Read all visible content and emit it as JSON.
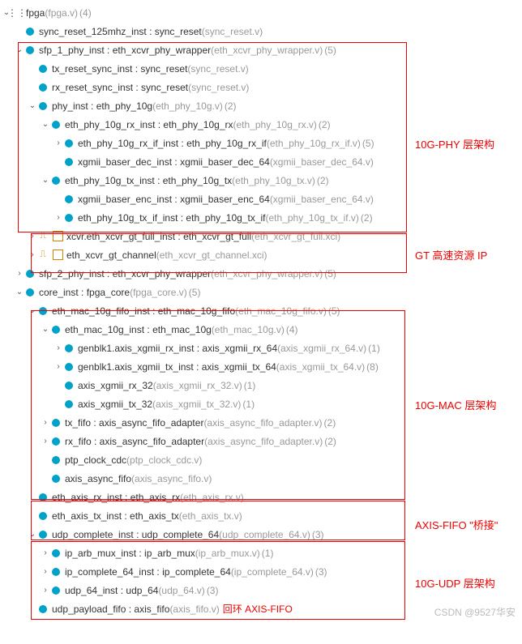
{
  "items": [
    {
      "d": 0,
      "a": "v",
      "i": "hier",
      "inst": "fpga",
      "file": "(fpga.v)",
      "cnt": "(4)"
    },
    {
      "d": 1,
      "a": "",
      "i": "dot",
      "inst": "sync_reset_125mhz_inst : sync_reset",
      "file": "(sync_reset.v)",
      "cnt": ""
    },
    {
      "d": 1,
      "a": "v",
      "i": "dot",
      "inst": "sfp_1_phy_inst : eth_xcvr_phy_wrapper",
      "file": "(eth_xcvr_phy_wrapper.v)",
      "cnt": "(5)"
    },
    {
      "d": 2,
      "a": "",
      "i": "dot",
      "inst": "tx_reset_sync_inst : sync_reset",
      "file": "(sync_reset.v)",
      "cnt": ""
    },
    {
      "d": 2,
      "a": "",
      "i": "dot",
      "inst": "rx_reset_sync_inst : sync_reset",
      "file": "(sync_reset.v)",
      "cnt": ""
    },
    {
      "d": 2,
      "a": "v",
      "i": "dot",
      "inst": "phy_inst : eth_phy_10g",
      "file": "(eth_phy_10g.v)",
      "cnt": "(2)"
    },
    {
      "d": 3,
      "a": "v",
      "i": "dot",
      "inst": "eth_phy_10g_rx_inst : eth_phy_10g_rx",
      "file": "(eth_phy_10g_rx.v)",
      "cnt": "(2)"
    },
    {
      "d": 4,
      "a": ">",
      "i": "dot",
      "inst": "eth_phy_10g_rx_if_inst : eth_phy_10g_rx_if",
      "file": "(eth_phy_10g_rx_if.v)",
      "cnt": "(5)"
    },
    {
      "d": 4,
      "a": "",
      "i": "dot",
      "inst": "xgmii_baser_dec_inst : xgmii_baser_dec_64",
      "file": "(xgmii_baser_dec_64.v)",
      "cnt": ""
    },
    {
      "d": 3,
      "a": "v",
      "i": "dot",
      "inst": "eth_phy_10g_tx_inst : eth_phy_10g_tx",
      "file": "(eth_phy_10g_tx.v)",
      "cnt": "(2)"
    },
    {
      "d": 4,
      "a": "",
      "i": "dot",
      "inst": "xgmii_baser_enc_inst : xgmii_baser_enc_64",
      "file": "(xgmii_baser_enc_64.v)",
      "cnt": ""
    },
    {
      "d": 4,
      "a": ">",
      "i": "dot",
      "inst": "eth_phy_10g_tx_if_inst : eth_phy_10g_tx_if",
      "file": "(eth_phy_10g_tx_if.v)",
      "cnt": "(2)"
    },
    {
      "d": 2,
      "a": ">",
      "i": "ip",
      "inst": "xcvr.eth_xcvr_gt_full_inst : eth_xcvr_gt_full",
      "file": "(eth_xcvr_gt_full.xci)",
      "cnt": ""
    },
    {
      "d": 2,
      "a": ">",
      "i": "ip",
      "inst": "eth_xcvr_gt_channel",
      "file": "(eth_xcvr_gt_channel.xci)",
      "cnt": ""
    },
    {
      "d": 1,
      "a": ">",
      "i": "dot",
      "inst": "sfp_2_phy_inst : eth_xcvr_phy_wrapper",
      "file": "(eth_xcvr_phy_wrapper.v)",
      "cnt": "(5)"
    },
    {
      "d": 1,
      "a": "v",
      "i": "dot",
      "inst": "core_inst : fpga_core",
      "file": "(fpga_core.v)",
      "cnt": "(5)"
    },
    {
      "d": 2,
      "a": "v",
      "i": "dot",
      "inst": "eth_mac_10g_fifo_inst : eth_mac_10g_fifo",
      "file": "(eth_mac_10g_fifo.v)",
      "cnt": "(5)"
    },
    {
      "d": 3,
      "a": "v",
      "i": "dot",
      "inst": "eth_mac_10g_inst : eth_mac_10g",
      "file": "(eth_mac_10g.v)",
      "cnt": "(4)"
    },
    {
      "d": 4,
      "a": ">",
      "i": "dot",
      "inst": "genblk1.axis_xgmii_rx_inst : axis_xgmii_rx_64",
      "file": "(axis_xgmii_rx_64.v)",
      "cnt": "(1)"
    },
    {
      "d": 4,
      "a": ">",
      "i": "dot",
      "inst": "genblk1.axis_xgmii_tx_inst : axis_xgmii_tx_64",
      "file": "(axis_xgmii_tx_64.v)",
      "cnt": "(8)"
    },
    {
      "d": 4,
      "a": "",
      "i": "dot",
      "inst": "axis_xgmii_rx_32",
      "file": "(axis_xgmii_rx_32.v)",
      "cnt": "(1)"
    },
    {
      "d": 4,
      "a": "",
      "i": "dot",
      "inst": "axis_xgmii_tx_32",
      "file": "(axis_xgmii_tx_32.v)",
      "cnt": "(1)"
    },
    {
      "d": 3,
      "a": ">",
      "i": "dot",
      "inst": "tx_fifo : axis_async_fifo_adapter",
      "file": "(axis_async_fifo_adapter.v)",
      "cnt": "(2)"
    },
    {
      "d": 3,
      "a": ">",
      "i": "dot",
      "inst": "rx_fifo : axis_async_fifo_adapter",
      "file": "(axis_async_fifo_adapter.v)",
      "cnt": "(2)"
    },
    {
      "d": 3,
      "a": "",
      "i": "dot",
      "inst": "ptp_clock_cdc",
      "file": "(ptp_clock_cdc.v)",
      "cnt": ""
    },
    {
      "d": 3,
      "a": "",
      "i": "dot",
      "inst": "axis_async_fifo",
      "file": "(axis_async_fifo.v)",
      "cnt": ""
    },
    {
      "d": 2,
      "a": "",
      "i": "dot",
      "inst": "eth_axis_rx_inst : eth_axis_rx",
      "file": "(eth_axis_rx.v)",
      "cnt": ""
    },
    {
      "d": 2,
      "a": "",
      "i": "dot",
      "inst": "eth_axis_tx_inst : eth_axis_tx",
      "file": "(eth_axis_tx.v)",
      "cnt": ""
    },
    {
      "d": 2,
      "a": "v",
      "i": "dot",
      "inst": "udp_complete_inst : udp_complete_64",
      "file": "(udp_complete_64.v)",
      "cnt": "(3)"
    },
    {
      "d": 3,
      "a": ">",
      "i": "dot",
      "inst": "ip_arb_mux_inst : ip_arb_mux",
      "file": "(ip_arb_mux.v)",
      "cnt": "(1)"
    },
    {
      "d": 3,
      "a": ">",
      "i": "dot",
      "inst": "ip_complete_64_inst : ip_complete_64",
      "file": "(ip_complete_64.v)",
      "cnt": "(3)"
    },
    {
      "d": 3,
      "a": ">",
      "i": "dot",
      "inst": "udp_64_inst : udp_64",
      "file": "(udp_64.v)",
      "cnt": "(3)"
    },
    {
      "d": 2,
      "a": "",
      "i": "dot",
      "inst": "udp_payload_fifo : axis_fifo",
      "file": "(axis_fifo.v)",
      "cnt": "",
      "after": "回环 AXIS-FIFO"
    }
  ],
  "labels": {
    "phy": "10G-PHY 层架构",
    "gt": "GT 高速资源 IP",
    "mac": "10G-MAC 层架构",
    "axis": "AXIS-FIFO \"桥接\"",
    "udp": "10G-UDP 层架构"
  },
  "watermark": "CSDN @9527华安"
}
